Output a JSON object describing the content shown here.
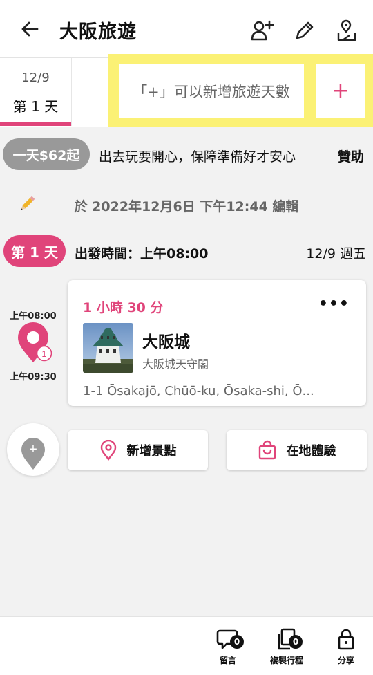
{
  "header": {
    "title": "大阪旅遊"
  },
  "days": {
    "tab": {
      "date": "12/9",
      "label": "第 1 天"
    },
    "hint": "「+」可以新增旅遊天數",
    "add_label": "+"
  },
  "promo": {
    "pill": "一天$62起",
    "text": "出去玩要開心，保障準備好才安心",
    "sponsor": "贊助"
  },
  "edit": {
    "text": "於 2022年12月6日 下午12:44 編輯"
  },
  "day": {
    "pill": "第 1 天",
    "depart": "出發時間：上午08:00",
    "date": "12/9 週五"
  },
  "stop": {
    "start": "上午08:00",
    "end": "上午09:30",
    "index": "1",
    "duration": "1 小時 30 分",
    "more": "•••",
    "name": "大阪城",
    "subtitle": "大阪城天守閣",
    "address": "1-1 Ōsakajō, Chūō-ku, Ōsaka-shi, Ō..."
  },
  "actions": {
    "add_fab": "+",
    "add_spot": "新增景點",
    "local_exp": "在地體驗"
  },
  "bottom": {
    "comments": {
      "label": "留言",
      "count": "0"
    },
    "copy": {
      "label": "複製行程",
      "count": "0"
    },
    "share": {
      "label": "分享"
    }
  },
  "colors": {
    "accent": "#e0447a",
    "highlight": "#fbf175",
    "grey_pill": "#999999"
  },
  "icons": [
    "back-arrow-icon",
    "add-person-icon",
    "pencil-icon",
    "map-pin-share-icon",
    "edit-pencil-emoji-icon",
    "location-pin-icon",
    "shopping-bag-icon",
    "comment-icon",
    "copy-icon",
    "lock-icon"
  ]
}
